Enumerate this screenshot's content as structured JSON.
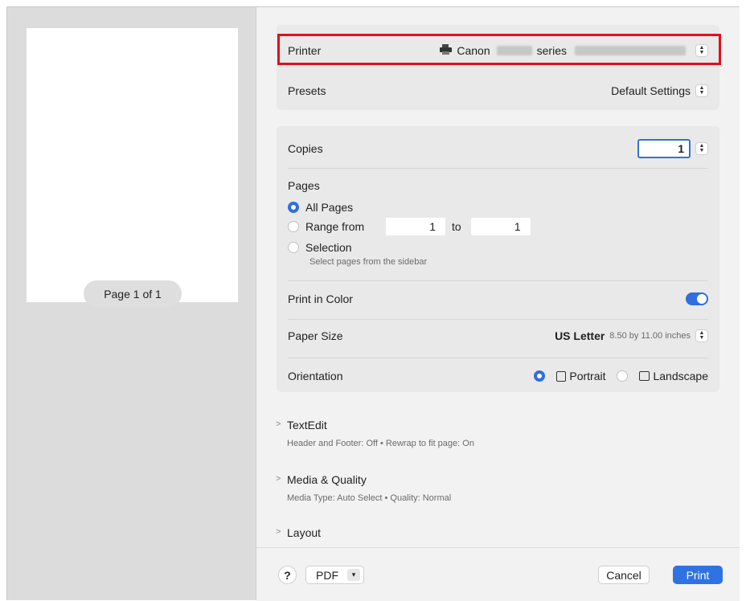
{
  "preview": {
    "page_indicator": "Page 1 of 1"
  },
  "printer": {
    "label": "Printer",
    "name": "Canon",
    "series_suffix": "series"
  },
  "presets": {
    "label": "Presets",
    "value": "Default Settings"
  },
  "copies": {
    "label": "Copies",
    "value": "1"
  },
  "pages": {
    "label": "Pages",
    "all_pages": "All Pages",
    "range_from": "Range from",
    "range_start": "1",
    "range_to": "to",
    "range_end": "1",
    "selection": "Selection",
    "selection_hint": "Select pages from the sidebar",
    "selected": "all_pages"
  },
  "color": {
    "label": "Print in Color",
    "enabled": true
  },
  "paper": {
    "label": "Paper Size",
    "value": "US Letter",
    "dimensions": "8.50 by 11.00 inches"
  },
  "orientation": {
    "label": "Orientation",
    "portrait": "Portrait",
    "landscape": "Landscape",
    "selected": "portrait"
  },
  "sections": [
    {
      "title": "TextEdit",
      "desc": "Header and Footer: Off • Rewrap to fit page: On"
    },
    {
      "title": "Media & Quality",
      "desc": "Media Type: Auto Select • Quality: Normal"
    },
    {
      "title": "Layout"
    }
  ],
  "footer": {
    "help": "?",
    "pdf": "PDF",
    "cancel": "Cancel",
    "print": "Print"
  },
  "colors": {
    "accent": "#2f6fde",
    "highlight": "#e0101e"
  },
  "icons": [
    "printer-icon",
    "stepper-icon",
    "chevron-right-icon",
    "chevron-down-icon",
    "portrait-icon",
    "landscape-icon"
  ]
}
